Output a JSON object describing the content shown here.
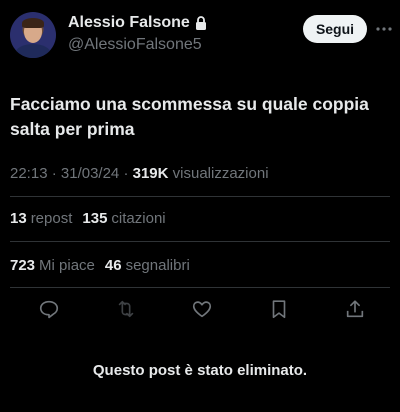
{
  "author": {
    "display_name": "Alessio Falsone",
    "handle": "@AlessioFalsone5",
    "protected_icon": "lock-icon"
  },
  "follow_button": {
    "label": "Segui"
  },
  "more_icon": "more-horizontal-icon",
  "post": {
    "text": "Facciamo una scommessa su quale coppia salta per prima",
    "time": "22:13",
    "date": "31/03/24",
    "views_count": "319K",
    "views_label": "visualizzazioni"
  },
  "stats": {
    "reposts_count": "13",
    "reposts_label": "repost",
    "quotes_count": "135",
    "quotes_label": "citazioni",
    "likes_count": "723",
    "likes_label": "Mi piace",
    "bookmarks_count": "46",
    "bookmarks_label": "segnalibri"
  },
  "actions": [
    {
      "name": "reply-icon"
    },
    {
      "name": "repost-icon"
    },
    {
      "name": "like-icon"
    },
    {
      "name": "bookmark-icon"
    },
    {
      "name": "share-icon"
    }
  ],
  "notice": "Questo post è stato eliminato.",
  "colors": {
    "background": "#000000",
    "text_primary": "#e7e9ea",
    "text_secondary": "#71767b",
    "divider": "#2f3336",
    "button_bg": "#eff3f4",
    "button_text": "#0f1419"
  }
}
